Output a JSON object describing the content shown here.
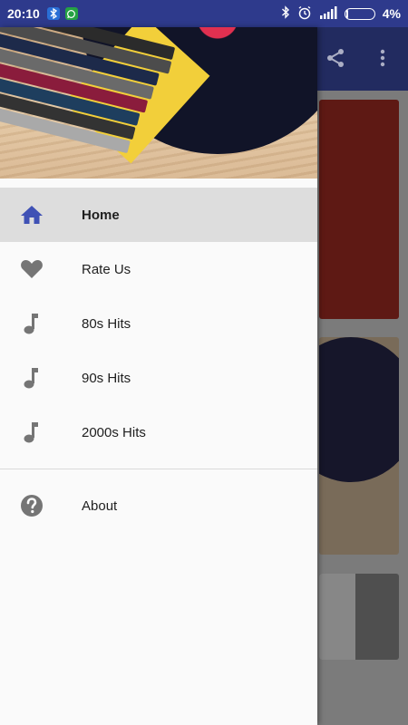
{
  "status_bar": {
    "time": "20:10",
    "notifications": [
      "bluetooth-notification-icon",
      "whatsapp-icon"
    ],
    "battery_level": 0.04,
    "battery_text": "4%",
    "icons": [
      "bluetooth-icon",
      "alarm-icon",
      "signal-icon",
      "battery-icon"
    ]
  },
  "background_app": {
    "toolbar_icons": [
      "share-icon",
      "more-vert-icon"
    ],
    "toolbar_color": "#27316e"
  },
  "drawer": {
    "header_image": "vinyl-records-stack",
    "items": [
      {
        "label": "Home",
        "icon": "home-icon",
        "active": true
      },
      {
        "label": "Rate Us",
        "icon": "heart-icon",
        "active": false
      },
      {
        "label": "80s Hits",
        "icon": "music-note-icon",
        "active": false
      },
      {
        "label": "90s Hits",
        "icon": "music-note-icon",
        "active": false
      },
      {
        "label": "2000s Hits",
        "icon": "music-note-icon",
        "active": false
      }
    ],
    "secondary_items": [
      {
        "label": "About",
        "icon": "help-icon",
        "active": false
      }
    ]
  },
  "colors": {
    "status_bar": "#2e3a8c",
    "accent": "#3f51b5",
    "icon_gray": "#757575",
    "active_bg": "#dddddd"
  }
}
